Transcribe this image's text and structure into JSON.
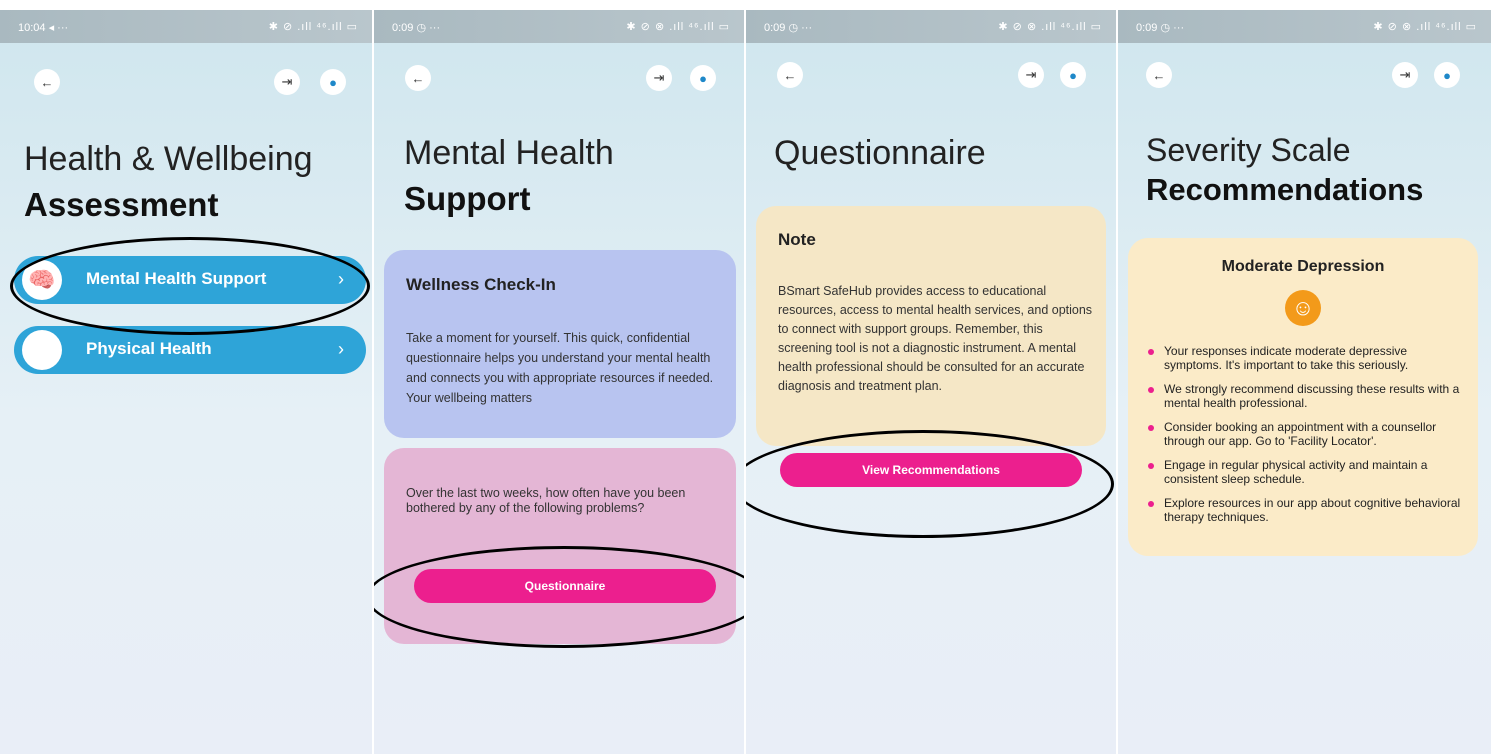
{
  "screen1": {
    "status_time": "10:04 ◂ ···",
    "status_icons": "✱ ⊘ .ıll ⁴⁶.ıll ▭",
    "title_line1": "Health & Wellbeing",
    "title_line2": "Assessment",
    "menu": [
      {
        "label": "Mental Health Support",
        "icon": "brain-icon"
      },
      {
        "label": "Physical Health",
        "icon": "heart-hand-icon"
      }
    ]
  },
  "screen2": {
    "status_time": "0:09 ◷ ···",
    "status_icons": "✱ ⊘ ⊗ .ıll ⁴⁶.ıll ▭",
    "title_line1": "Mental Health",
    "title_line2": "Support",
    "card1_title": "Wellness Check-In",
    "card1_text": "Take a moment for yourself. This quick, confidential questionnaire helps you understand your mental health and connects you with appropriate resources if needed. Your wellbeing matters",
    "card2_text": "Over the last two weeks, how often have you been bothered by any of the following problems?",
    "button": "Questionnaire"
  },
  "screen3": {
    "status_time": "0:09 ◷ ···",
    "status_icons": "✱ ⊘ ⊗ .ıll ⁴⁶.ıll ▭",
    "title": "Questionnaire",
    "note_title": "Note",
    "note_text": "BSmart SafeHub provides access to educational resources, access to mental health services, and options to connect with support groups. Remember, this screening tool is not a diagnostic instrument. A mental health professional should be consulted for an accurate diagnosis and treatment plan.",
    "button": "View Recommendations"
  },
  "screen4": {
    "status_time": "0:09 ◷ ···",
    "status_icons": "✱ ⊘ ⊗ .ıll ⁴⁶.ıll ▭",
    "title_line1": "Severity Scale",
    "title_line2": "Recommendations",
    "card_title": "Moderate Depression",
    "recommendations": [
      "Your responses indicate moderate depressive symptoms. It's important to take this seriously.",
      "We strongly recommend discussing these results with a mental health professional.",
      "Consider booking an appointment with a counsellor through our app. Go to 'Facility Locator'.",
      "Engage in regular physical activity and maintain a consistent sleep schedule.",
      "Explore resources in our app about cognitive behavioral therapy techniques."
    ]
  },
  "colors": {
    "accent_blue": "#2ea4d8",
    "accent_pink": "#ec1f8e",
    "card_lavender": "#b8c4f0",
    "card_pink": "#e4b6d5",
    "card_cream": "#f5e7c6",
    "smiley_orange": "#f39a1a"
  },
  "icons": {
    "back": "arrow-left-icon",
    "logout": "logout-icon",
    "profile": "user-icon"
  }
}
